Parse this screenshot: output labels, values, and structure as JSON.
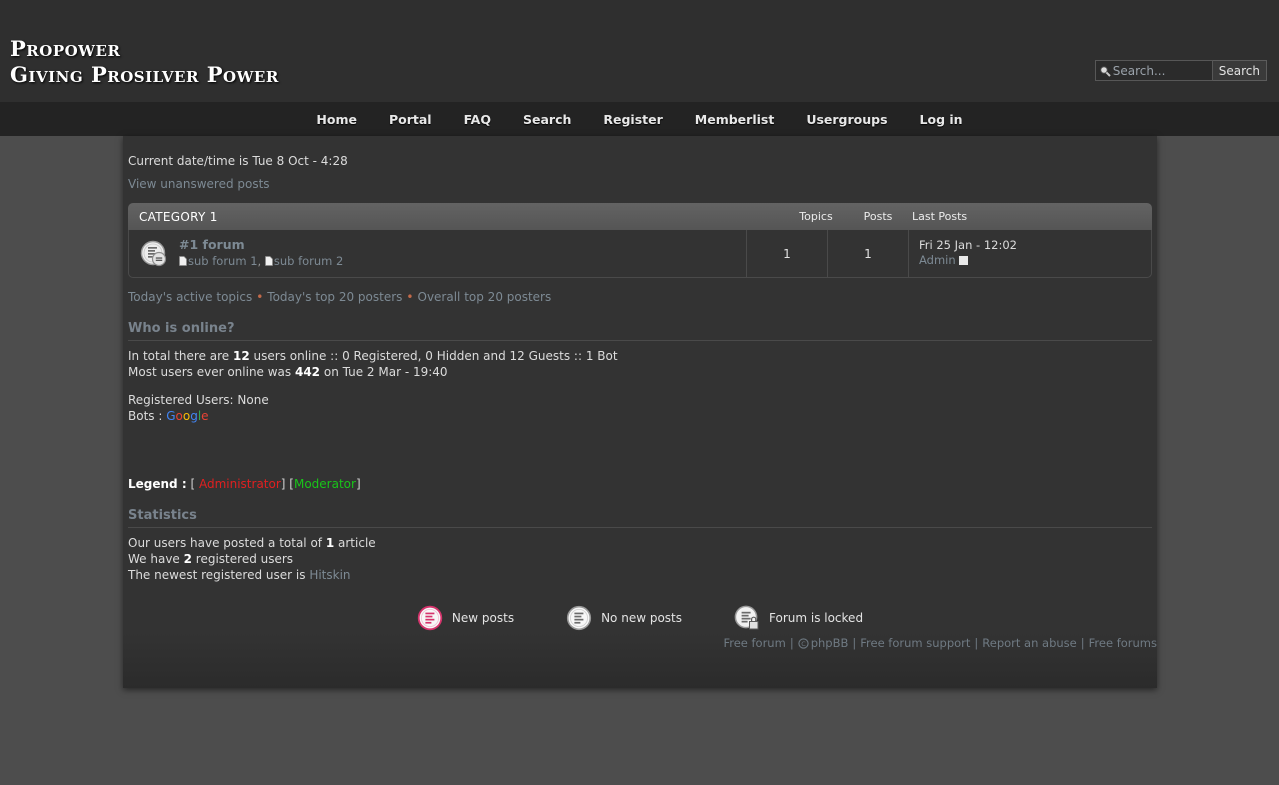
{
  "header": {
    "logo_line1": "Propower",
    "logo_line2": "Giving Prosilver Power",
    "search": {
      "placeholder": "Search...",
      "value": "",
      "button_label": "Search",
      "icon": "search-icon"
    }
  },
  "nav": {
    "items": [
      {
        "label": "Home"
      },
      {
        "label": "Portal"
      },
      {
        "label": "FAQ"
      },
      {
        "label": "Search"
      },
      {
        "label": "Register"
      },
      {
        "label": "Memberlist"
      },
      {
        "label": "Usergroups"
      },
      {
        "label": "Log in"
      }
    ]
  },
  "main": {
    "datetime": "Current date/time is Tue 8 Oct - 4:28",
    "unanswered_link": "View unanswered posts",
    "table": {
      "category_title": "CATEGORY 1",
      "columns": {
        "topics": "Topics",
        "posts": "Posts",
        "last_posts": "Last Posts"
      },
      "rows": [
        {
          "icon": "forum-no-new-posts-icon",
          "name": "#1 forum",
          "subforums": [
            {
              "label": "sub forum 1"
            },
            {
              "label": "sub forum 2"
            }
          ],
          "subforum_separator": ", ",
          "topics": "1",
          "posts": "1",
          "last_post_date": "Fri 25 Jan - 12:02",
          "last_post_author": "Admin"
        }
      ]
    },
    "quicklinks": [
      {
        "label": "Today's active topics"
      },
      {
        "label": "Today's top 20 posters"
      },
      {
        "label": "Overall top 20 posters"
      }
    ],
    "quicklink_bullet": "•",
    "who_is_online": {
      "title": "Who is online?",
      "total_prefix": " In total there are ",
      "total_count": "12",
      "total_suffix": " users online :: 0 Registered, 0 Hidden and 12 Guests :: 1 Bot",
      "record_prefix": "Most users ever online was ",
      "record_count": "442",
      "record_suffix": " on Tue 2 Mar - 19:40",
      "registered_users": "Registered Users: None",
      "bots_label": "Bots : ",
      "bot_name": "Google",
      "bot_letters": [
        {
          "ch": "G",
          "color": "#4285f4"
        },
        {
          "ch": "o",
          "color": "#ea4335"
        },
        {
          "ch": "o",
          "color": "#fbbc05"
        },
        {
          "ch": "g",
          "color": "#4285f4"
        },
        {
          "ch": "l",
          "color": "#34a853"
        },
        {
          "ch": "e",
          "color": "#ea4335"
        }
      ]
    },
    "legend": {
      "label": "Legend :",
      "open_bracket": "[",
      "close_bracket": "]",
      "administrator": "Administrator",
      "moderator": "Moderator",
      "admin_color": "#e02020",
      "mod_color": "#19c419"
    },
    "statistics": {
      "title": "Statistics",
      "total_prefix": "Our users have posted a total of ",
      "total_count": "1",
      "total_suffix": " article",
      "users_prefix": "We have ",
      "users_count": "2",
      "users_suffix": " registered users",
      "newest_prefix": "The newest registered user is ",
      "newest_user": "Hitskin"
    },
    "icon_legend": [
      {
        "icon": "new-posts-icon",
        "label": "New posts"
      },
      {
        "icon": "no-new-posts-icon",
        "label": "No new posts"
      },
      {
        "icon": "forum-locked-icon",
        "label": "Forum is locked"
      }
    ]
  },
  "footer": {
    "links": [
      {
        "label": "Free forum"
      },
      {
        "label": "phpBB",
        "icon": "copyright-icon"
      },
      {
        "label": "Free forum support"
      },
      {
        "label": "Report an abuse"
      },
      {
        "label": "Free forums"
      }
    ],
    "separator": "|"
  }
}
